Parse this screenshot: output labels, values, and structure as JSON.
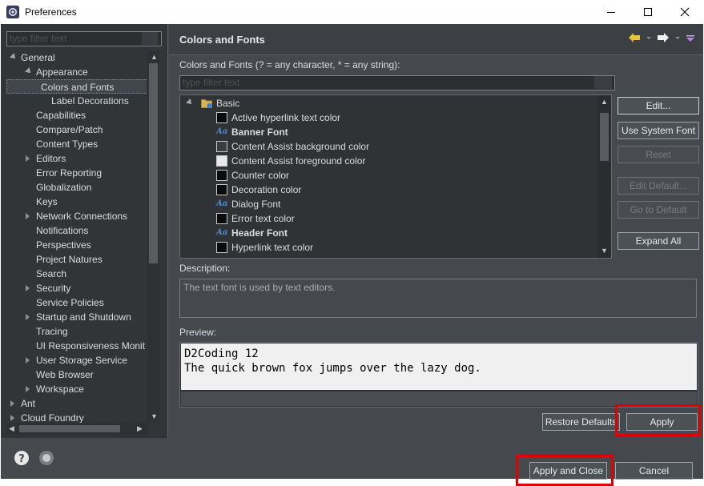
{
  "window": {
    "title": "Preferences",
    "minimize_icon": "minimize-icon",
    "maximize_icon": "maximize-icon",
    "close_icon": "close-icon"
  },
  "nav": {
    "filter_placeholder": "type filter text",
    "items": [
      {
        "label": "General",
        "level": 0,
        "expander": "open"
      },
      {
        "label": "Appearance",
        "level": 1,
        "expander": "open"
      },
      {
        "label": "Colors and Fonts",
        "level": 2,
        "expander": "none",
        "selected": true
      },
      {
        "label": "Label Decorations",
        "level": 2,
        "expander": "none"
      },
      {
        "label": "Capabilities",
        "level": 1,
        "expander": "none"
      },
      {
        "label": "Compare/Patch",
        "level": 1,
        "expander": "none"
      },
      {
        "label": "Content Types",
        "level": 1,
        "expander": "none"
      },
      {
        "label": "Editors",
        "level": 1,
        "expander": "closed"
      },
      {
        "label": "Error Reporting",
        "level": 1,
        "expander": "none"
      },
      {
        "label": "Globalization",
        "level": 1,
        "expander": "none"
      },
      {
        "label": "Keys",
        "level": 1,
        "expander": "none"
      },
      {
        "label": "Network Connections",
        "level": 1,
        "expander": "closed"
      },
      {
        "label": "Notifications",
        "level": 1,
        "expander": "none"
      },
      {
        "label": "Perspectives",
        "level": 1,
        "expander": "none"
      },
      {
        "label": "Project Natures",
        "level": 1,
        "expander": "none"
      },
      {
        "label": "Search",
        "level": 1,
        "expander": "none"
      },
      {
        "label": "Security",
        "level": 1,
        "expander": "closed"
      },
      {
        "label": "Service Policies",
        "level": 1,
        "expander": "none"
      },
      {
        "label": "Startup and Shutdown",
        "level": 1,
        "expander": "closed"
      },
      {
        "label": "Tracing",
        "level": 1,
        "expander": "none"
      },
      {
        "label": "UI Responsiveness Monit",
        "level": 1,
        "expander": "none"
      },
      {
        "label": "User Storage Service",
        "level": 1,
        "expander": "closed"
      },
      {
        "label": "Web Browser",
        "level": 1,
        "expander": "none"
      },
      {
        "label": "Workspace",
        "level": 1,
        "expander": "closed"
      },
      {
        "label": "Ant",
        "level": 0,
        "expander": "closed"
      },
      {
        "label": "Cloud Foundry",
        "level": 0,
        "expander": "closed"
      }
    ]
  },
  "page": {
    "title": "Colors and Fonts",
    "back_icon": "back-arrow-icon",
    "forward_icon": "forward-arrow-icon",
    "menu_icon": "view-menu-icon",
    "list_label": "Colors and Fonts (? = any character, * = any string):",
    "filter_placeholder": "type filter text",
    "category": "Basic",
    "entries": [
      {
        "label": "Active hyperlink text color",
        "kind": "color",
        "color": "#0b0b0b",
        "bold": false
      },
      {
        "label": "Banner Font",
        "kind": "font",
        "bold": true
      },
      {
        "label": "Content Assist background color",
        "kind": "color",
        "color": "#3a3e42",
        "bold": false
      },
      {
        "label": "Content Assist foreground color",
        "kind": "color",
        "color": "#e8e8e8",
        "bold": false
      },
      {
        "label": "Counter color",
        "kind": "color",
        "color": "#0b0b0b",
        "bold": false
      },
      {
        "label": "Decoration color",
        "kind": "color",
        "color": "#0b0b0b",
        "bold": false
      },
      {
        "label": "Dialog Font",
        "kind": "font",
        "bold": false
      },
      {
        "label": "Error text color",
        "kind": "color",
        "color": "#0b0b0b",
        "bold": false
      },
      {
        "label": "Header Font",
        "kind": "font",
        "bold": true
      },
      {
        "label": "Hyperlink text color",
        "kind": "color",
        "color": "#0b0b0b",
        "bold": false
      }
    ],
    "buttons": {
      "edit": "Edit...",
      "use_system_font": "Use System Font",
      "reset": "Reset",
      "edit_default": "Edit Default...",
      "go_to_default": "Go to Default",
      "expand_all": "Expand All"
    },
    "description_label": "Description:",
    "description_text": "The text font is used by text editors.",
    "preview_label": "Preview:",
    "preview_line1": "D2Coding 12",
    "preview_line2": "The quick brown fox jumps over the lazy dog.",
    "restore_defaults": "Restore Defaults",
    "apply": "Apply"
  },
  "footer": {
    "help_icon": "help-icon",
    "import_icon": "record-icon",
    "apply_and_close": "Apply and Close",
    "cancel": "Cancel"
  },
  "colors": {
    "highlight": "#e00000",
    "font_icon": "#4e8bd6"
  }
}
